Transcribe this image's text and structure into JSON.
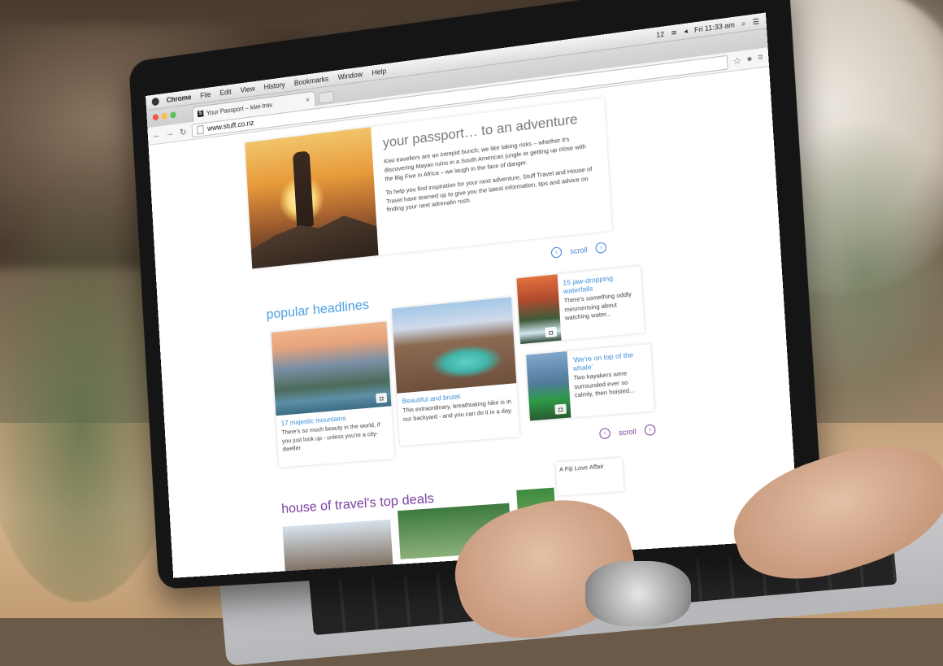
{
  "menubar": {
    "app_name": "Chrome",
    "items": [
      "File",
      "Edit",
      "View",
      "History",
      "Bookmarks",
      "Window",
      "Help"
    ],
    "clock": "Fri 11:33 am",
    "battery": "12"
  },
  "browser": {
    "tab_title": "Your Passport – kiwi-trav",
    "tab_favicon": "S",
    "url": "www.stuff.co.nz"
  },
  "hero": {
    "title": "your passport… to an adventure",
    "para1": "Kiwi travellers are an intrepid bunch; we like taking risks – whether it's discovering Mayan ruins in a South American jungle or getting up close with the Big Five in Africa – we laugh in the face of danger.",
    "para2": "To help you find inspiration for your next adventure, Stuff Travel and House of Travel have teamed up to give you the latest information, tips and advice on finding your next adrenalin rush."
  },
  "scroll_label": "scroll",
  "popular": {
    "heading": "popular headlines",
    "cards": [
      {
        "title": "17 majestic mountains",
        "desc": "There's so much beauty in the world, if you just look up - unless you're a city-dweller."
      },
      {
        "title": "Beautiful and brutal",
        "desc": "This extraordinary, breathtaking hike is in our backyard - and you can do it in a day."
      },
      {
        "title": "15 jaw-dropping waterfalls",
        "desc": "There's something oddly mesmerising about watching water..."
      },
      {
        "title": "'We're on top of the whale'",
        "desc": "Two kayakers were surrounded ever so calmly, then hoisted..."
      }
    ]
  },
  "deals": {
    "heading": "house of travel's top deals",
    "card_text": "A Fiji Love Affair"
  },
  "colors": {
    "popular_accent": "#4aa1e0",
    "deals_accent": "#7b3fa0"
  }
}
